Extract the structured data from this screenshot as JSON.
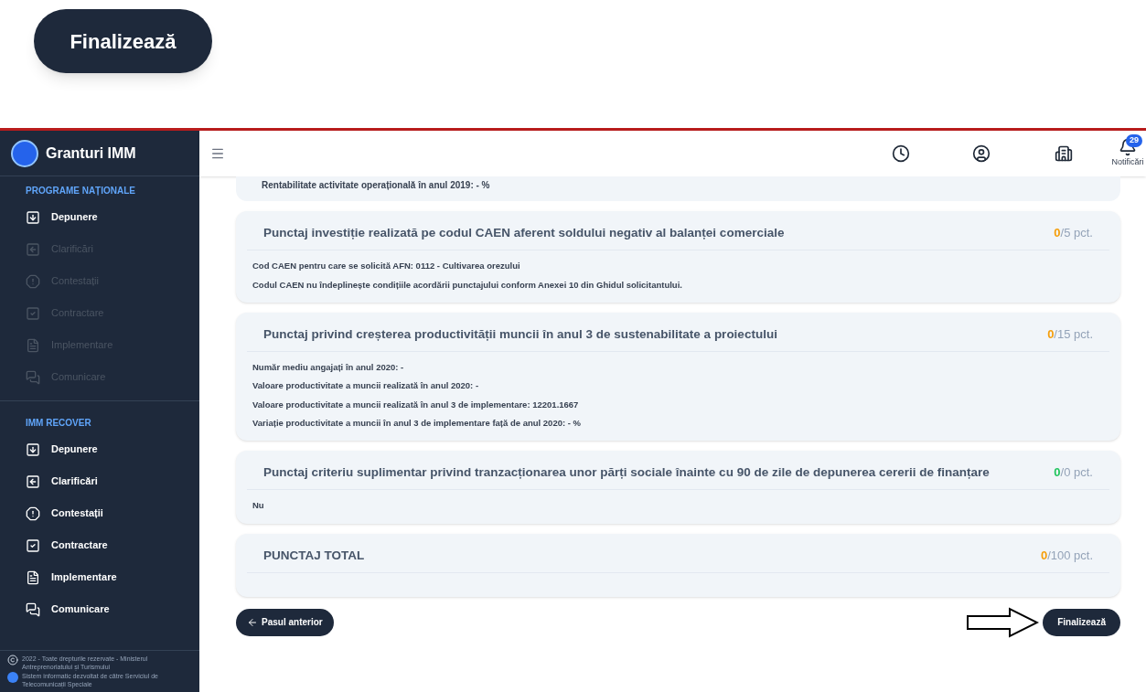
{
  "callout_button": "Finalizează",
  "sidebar": {
    "brand": "Granturi IMM",
    "sections": [
      {
        "title": "PROGRAME NAȚIONALE",
        "items": [
          {
            "label": "Depunere",
            "disabled": false
          },
          {
            "label": "Clarificări",
            "disabled": true
          },
          {
            "label": "Contestații",
            "disabled": true
          },
          {
            "label": "Contractare",
            "disabled": true
          },
          {
            "label": "Implementare",
            "disabled": true
          },
          {
            "label": "Comunicare",
            "disabled": true
          }
        ]
      },
      {
        "title": "IMM RECOVER",
        "items": [
          {
            "label": "Depunere",
            "disabled": false
          },
          {
            "label": "Clarificări",
            "disabled": false
          },
          {
            "label": "Contestații",
            "disabled": false
          },
          {
            "label": "Contractare",
            "disabled": false
          },
          {
            "label": "Implementare",
            "disabled": false
          },
          {
            "label": "Comunicare",
            "disabled": false
          }
        ]
      }
    ],
    "footer": [
      "2022 - Toate drepturile rezervate - Ministerul Antreprenoriatului și Turismului",
      "Sistem informatic dezvoltat de către Serviciul de Telecomunicații Speciale"
    ]
  },
  "header": {
    "notification_count": "29",
    "notifications_label": "Notificări"
  },
  "partial_card_text": "Rentabilitate activitate operațională în anul 2019: - %",
  "cards": [
    {
      "title": "Punctaj investiție realizată pe codul CAEN aferent soldului negativ al balanței comerciale",
      "score": "0",
      "max": "/5 pct.",
      "color": "#f59e0b",
      "lines": [
        "Cod CAEN pentru care se solicită AFN: 0112 - Cultivarea orezului",
        "Codul CAEN nu îndeplinește condițiile acordării punctajului conform Anexei 10 din Ghidul solicitantului."
      ]
    },
    {
      "title": "Punctaj privind creșterea productivității muncii în anul 3 de sustenabilitate a proiectului",
      "score": "0",
      "max": "/15 pct.",
      "color": "#f59e0b",
      "lines": [
        "Număr mediu angajați în anul 2020: -",
        "Valoare productivitate a muncii realizată în anul 2020: -",
        "Valoare productivitate a muncii realizată în anul 3 de implementare: 12201.1667",
        "Variație productivitate a muncii în anul 3 de implementare față de anul 2020: - %"
      ]
    },
    {
      "title": "Punctaj criteriu suplimentar privind tranzacționarea unor părți sociale înainte cu 90 de zile de depunerea cererii de finanțare",
      "score": "0",
      "max": "/0 pct.",
      "color": "#22c55e",
      "lines": [
        "Nu"
      ]
    },
    {
      "title": "PUNCTAJ TOTAL",
      "score": "0",
      "max": "/100 pct.",
      "color": "#f59e0b"
    }
  ],
  "back_button": "Pasul anterior",
  "finish_button": "Finalizează"
}
